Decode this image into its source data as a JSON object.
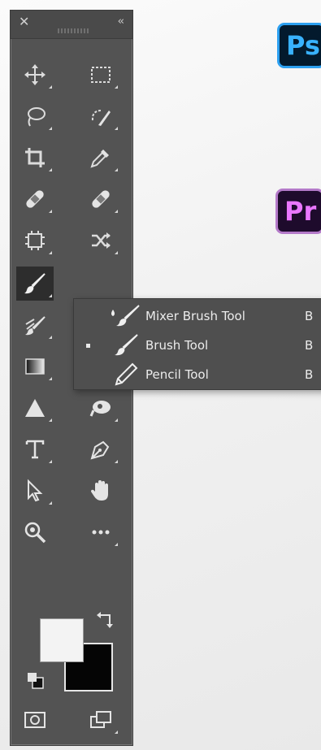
{
  "toolbar": {
    "close_glyph": "✕",
    "collapse_glyph": "‹‹",
    "tools": [
      {
        "name": "move-tool",
        "icon": "move-icon"
      },
      {
        "name": "marquee-tool",
        "icon": "rectangular-marquee-icon"
      },
      {
        "name": "lasso-tool",
        "icon": "lasso-icon"
      },
      {
        "name": "quick-selection-tool",
        "icon": "quick-selection-icon"
      },
      {
        "name": "crop-tool",
        "icon": "crop-icon"
      },
      {
        "name": "eyedropper-tool",
        "icon": "eyedropper-icon"
      },
      {
        "name": "healing-brush-tool",
        "icon": "bandage-icon"
      },
      {
        "name": "patch-tool",
        "icon": "bandage-icon"
      },
      {
        "name": "content-aware-tool",
        "icon": "frame-icon"
      },
      {
        "name": "content-move-tool",
        "icon": "cross-arrows-icon"
      },
      {
        "name": "brush-tool",
        "icon": "brush-icon",
        "active": true
      },
      {
        "name": "clone-stamp-tool",
        "icon": "stamp-icon"
      },
      {
        "name": "history-brush-tool",
        "icon": "history-brush-icon"
      },
      {
        "name": "smudge-tool",
        "icon": "smudge-icon"
      },
      {
        "name": "gradient-tool",
        "icon": "gradient-icon"
      },
      {
        "name": "blur-tool",
        "icon": "blur-icon"
      },
      {
        "name": "sharpen-tool",
        "icon": "triangle-icon"
      },
      {
        "name": "dodge-tool",
        "icon": "dodge-icon"
      },
      {
        "name": "type-tool",
        "icon": "type-icon"
      },
      {
        "name": "pen-tool",
        "icon": "pen-icon"
      },
      {
        "name": "path-selection-tool",
        "icon": "arrow-cursor-icon"
      },
      {
        "name": "hand-tool",
        "icon": "hand-icon"
      },
      {
        "name": "zoom-tool",
        "icon": "magnifier-icon"
      },
      {
        "name": "more-tools",
        "icon": "ellipsis-icon"
      }
    ],
    "foreground_color": "#f3f3f3",
    "background_color": "#050505"
  },
  "flyout": {
    "items": [
      {
        "label": "Mixer Brush Tool",
        "shortcut": "B",
        "icon": "mixer-brush-icon",
        "selected": false
      },
      {
        "label": "Brush Tool",
        "shortcut": "B",
        "icon": "brush-icon",
        "selected": true
      },
      {
        "label": "Pencil Tool",
        "shortcut": "B",
        "icon": "pencil-icon",
        "selected": false
      }
    ]
  },
  "badges": {
    "photoshop": "Ps",
    "premiere": "Pr"
  },
  "colors": {
    "panel": "#535353",
    "ps_accent": "#38b2ff",
    "pr_accent": "#ea77ff"
  }
}
